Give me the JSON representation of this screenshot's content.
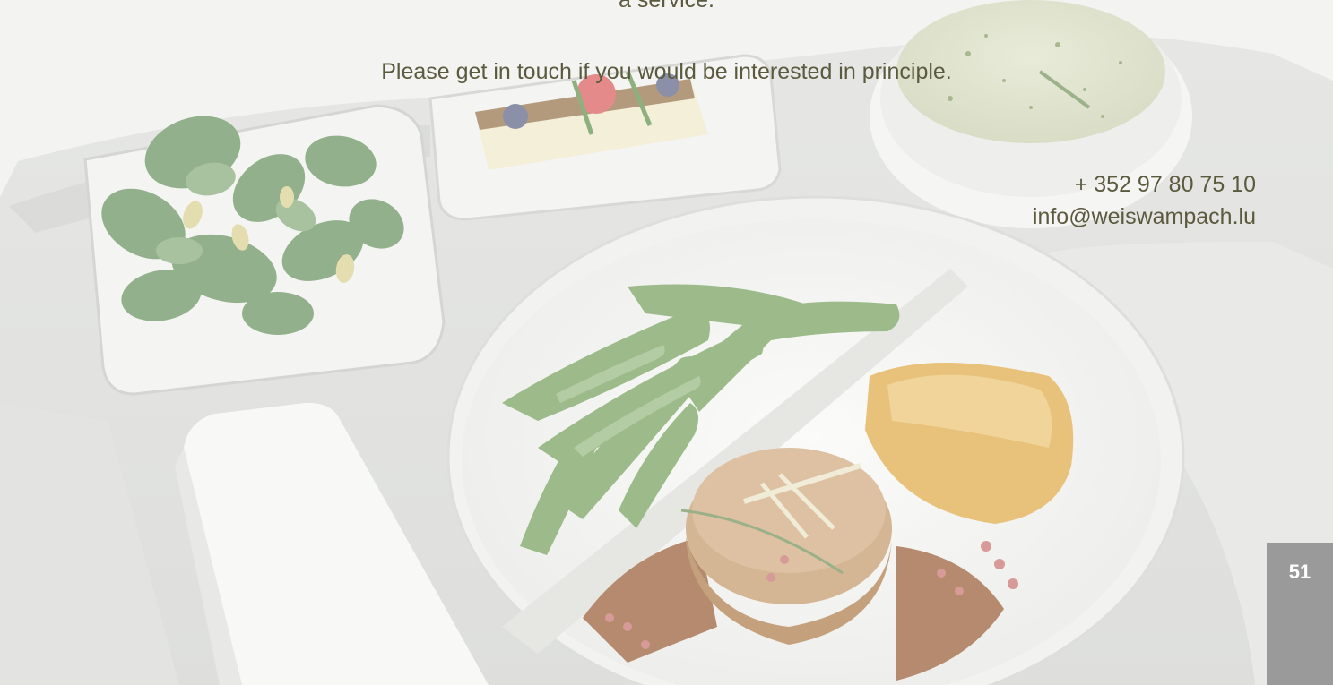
{
  "text": {
    "intro_tail": "a service.",
    "cta": "Please get in touch if you would be interested in principle."
  },
  "contact": {
    "phone": "+ 352 97 80 75 10",
    "email": "info@weiswampach.lu"
  },
  "page": {
    "number": "51"
  },
  "colors": {
    "text": "#5b5a3f",
    "page_tab": "#9a9a9a",
    "background": "#f2f2f0"
  }
}
